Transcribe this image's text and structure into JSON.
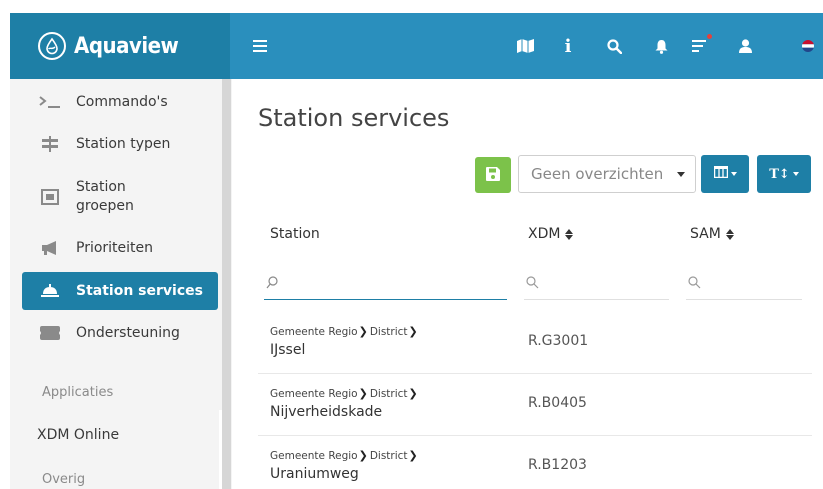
{
  "brand": {
    "name": "Aquaview"
  },
  "topbar": {
    "icons": [
      "menu-icon",
      "map-icon",
      "info-icon",
      "search-icon",
      "bell-icon",
      "task-list-icon",
      "user-icon",
      "flag-nl-icon"
    ],
    "notification_color": "#e6413a",
    "info_glyph": "i"
  },
  "sidebar": {
    "items": [
      {
        "label": "Commando's",
        "icon": "terminal-icon"
      },
      {
        "label": "Station typen",
        "icon": "signpost-icon"
      },
      {
        "label": "Station groepen",
        "icon": "station-group-icon"
      },
      {
        "label": "Prioriteiten",
        "icon": "megaphone-icon"
      },
      {
        "label": "Station services",
        "icon": "service-bell-icon",
        "active": true
      },
      {
        "label": "Ondersteuning",
        "icon": "ticket-icon"
      }
    ],
    "section_apps": "Applicaties",
    "link_xdm": "XDM Online",
    "section_other": "Overig"
  },
  "main": {
    "title": "Station services",
    "toolbar": {
      "overview_value": "Geen overzichten",
      "text_size_label": "T↕"
    },
    "columns": [
      {
        "label": "Station"
      },
      {
        "label": "XDM"
      },
      {
        "label": "SAM"
      }
    ],
    "rows": [
      {
        "crumb1": "Gemeente Regio",
        "crumb2": "District",
        "name": "IJssel",
        "xdm": "R.G3001"
      },
      {
        "crumb1": "Gemeente Regio",
        "crumb2": "District",
        "name": "Nijverheidskade",
        "xdm": "R.B0405"
      },
      {
        "crumb1": "Gemeente Regio",
        "crumb2": "District",
        "name": "Uraniumweg",
        "xdm": "R.B1203"
      }
    ]
  },
  "colors": {
    "brand": "#1e7fa6",
    "topbar": "#2a8fbd",
    "save": "#7cc24a"
  }
}
